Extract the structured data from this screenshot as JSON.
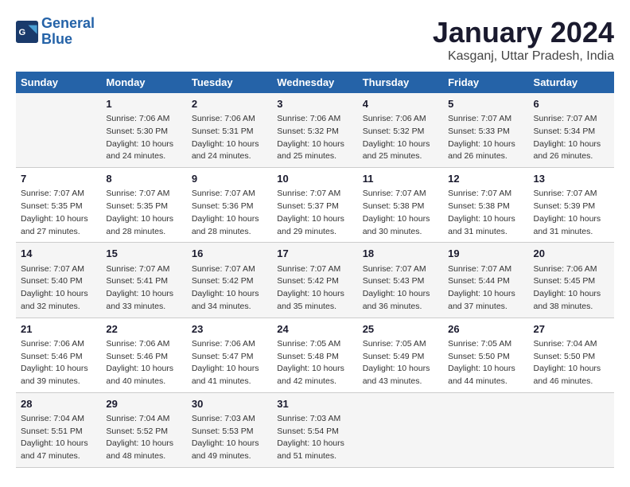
{
  "logo": {
    "text_general": "General",
    "text_blue": "Blue"
  },
  "title": "January 2024",
  "subtitle": "Kasganj, Uttar Pradesh, India",
  "days_header": [
    "Sunday",
    "Monday",
    "Tuesday",
    "Wednesday",
    "Thursday",
    "Friday",
    "Saturday"
  ],
  "weeks": [
    [
      {
        "num": "",
        "sunrise": "",
        "sunset": "",
        "daylight": ""
      },
      {
        "num": "1",
        "sunrise": "Sunrise: 7:06 AM",
        "sunset": "Sunset: 5:30 PM",
        "daylight": "Daylight: 10 hours and 24 minutes."
      },
      {
        "num": "2",
        "sunrise": "Sunrise: 7:06 AM",
        "sunset": "Sunset: 5:31 PM",
        "daylight": "Daylight: 10 hours and 24 minutes."
      },
      {
        "num": "3",
        "sunrise": "Sunrise: 7:06 AM",
        "sunset": "Sunset: 5:32 PM",
        "daylight": "Daylight: 10 hours and 25 minutes."
      },
      {
        "num": "4",
        "sunrise": "Sunrise: 7:06 AM",
        "sunset": "Sunset: 5:32 PM",
        "daylight": "Daylight: 10 hours and 25 minutes."
      },
      {
        "num": "5",
        "sunrise": "Sunrise: 7:07 AM",
        "sunset": "Sunset: 5:33 PM",
        "daylight": "Daylight: 10 hours and 26 minutes."
      },
      {
        "num": "6",
        "sunrise": "Sunrise: 7:07 AM",
        "sunset": "Sunset: 5:34 PM",
        "daylight": "Daylight: 10 hours and 26 minutes."
      }
    ],
    [
      {
        "num": "7",
        "sunrise": "Sunrise: 7:07 AM",
        "sunset": "Sunset: 5:35 PM",
        "daylight": "Daylight: 10 hours and 27 minutes."
      },
      {
        "num": "8",
        "sunrise": "Sunrise: 7:07 AM",
        "sunset": "Sunset: 5:35 PM",
        "daylight": "Daylight: 10 hours and 28 minutes."
      },
      {
        "num": "9",
        "sunrise": "Sunrise: 7:07 AM",
        "sunset": "Sunset: 5:36 PM",
        "daylight": "Daylight: 10 hours and 28 minutes."
      },
      {
        "num": "10",
        "sunrise": "Sunrise: 7:07 AM",
        "sunset": "Sunset: 5:37 PM",
        "daylight": "Daylight: 10 hours and 29 minutes."
      },
      {
        "num": "11",
        "sunrise": "Sunrise: 7:07 AM",
        "sunset": "Sunset: 5:38 PM",
        "daylight": "Daylight: 10 hours and 30 minutes."
      },
      {
        "num": "12",
        "sunrise": "Sunrise: 7:07 AM",
        "sunset": "Sunset: 5:38 PM",
        "daylight": "Daylight: 10 hours and 31 minutes."
      },
      {
        "num": "13",
        "sunrise": "Sunrise: 7:07 AM",
        "sunset": "Sunset: 5:39 PM",
        "daylight": "Daylight: 10 hours and 31 minutes."
      }
    ],
    [
      {
        "num": "14",
        "sunrise": "Sunrise: 7:07 AM",
        "sunset": "Sunset: 5:40 PM",
        "daylight": "Daylight: 10 hours and 32 minutes."
      },
      {
        "num": "15",
        "sunrise": "Sunrise: 7:07 AM",
        "sunset": "Sunset: 5:41 PM",
        "daylight": "Daylight: 10 hours and 33 minutes."
      },
      {
        "num": "16",
        "sunrise": "Sunrise: 7:07 AM",
        "sunset": "Sunset: 5:42 PM",
        "daylight": "Daylight: 10 hours and 34 minutes."
      },
      {
        "num": "17",
        "sunrise": "Sunrise: 7:07 AM",
        "sunset": "Sunset: 5:42 PM",
        "daylight": "Daylight: 10 hours and 35 minutes."
      },
      {
        "num": "18",
        "sunrise": "Sunrise: 7:07 AM",
        "sunset": "Sunset: 5:43 PM",
        "daylight": "Daylight: 10 hours and 36 minutes."
      },
      {
        "num": "19",
        "sunrise": "Sunrise: 7:07 AM",
        "sunset": "Sunset: 5:44 PM",
        "daylight": "Daylight: 10 hours and 37 minutes."
      },
      {
        "num": "20",
        "sunrise": "Sunrise: 7:06 AM",
        "sunset": "Sunset: 5:45 PM",
        "daylight": "Daylight: 10 hours and 38 minutes."
      }
    ],
    [
      {
        "num": "21",
        "sunrise": "Sunrise: 7:06 AM",
        "sunset": "Sunset: 5:46 PM",
        "daylight": "Daylight: 10 hours and 39 minutes."
      },
      {
        "num": "22",
        "sunrise": "Sunrise: 7:06 AM",
        "sunset": "Sunset: 5:46 PM",
        "daylight": "Daylight: 10 hours and 40 minutes."
      },
      {
        "num": "23",
        "sunrise": "Sunrise: 7:06 AM",
        "sunset": "Sunset: 5:47 PM",
        "daylight": "Daylight: 10 hours and 41 minutes."
      },
      {
        "num": "24",
        "sunrise": "Sunrise: 7:05 AM",
        "sunset": "Sunset: 5:48 PM",
        "daylight": "Daylight: 10 hours and 42 minutes."
      },
      {
        "num": "25",
        "sunrise": "Sunrise: 7:05 AM",
        "sunset": "Sunset: 5:49 PM",
        "daylight": "Daylight: 10 hours and 43 minutes."
      },
      {
        "num": "26",
        "sunrise": "Sunrise: 7:05 AM",
        "sunset": "Sunset: 5:50 PM",
        "daylight": "Daylight: 10 hours and 44 minutes."
      },
      {
        "num": "27",
        "sunrise": "Sunrise: 7:04 AM",
        "sunset": "Sunset: 5:50 PM",
        "daylight": "Daylight: 10 hours and 46 minutes."
      }
    ],
    [
      {
        "num": "28",
        "sunrise": "Sunrise: 7:04 AM",
        "sunset": "Sunset: 5:51 PM",
        "daylight": "Daylight: 10 hours and 47 minutes."
      },
      {
        "num": "29",
        "sunrise": "Sunrise: 7:04 AM",
        "sunset": "Sunset: 5:52 PM",
        "daylight": "Daylight: 10 hours and 48 minutes."
      },
      {
        "num": "30",
        "sunrise": "Sunrise: 7:03 AM",
        "sunset": "Sunset: 5:53 PM",
        "daylight": "Daylight: 10 hours and 49 minutes."
      },
      {
        "num": "31",
        "sunrise": "Sunrise: 7:03 AM",
        "sunset": "Sunset: 5:54 PM",
        "daylight": "Daylight: 10 hours and 51 minutes."
      },
      {
        "num": "",
        "sunrise": "",
        "sunset": "",
        "daylight": ""
      },
      {
        "num": "",
        "sunrise": "",
        "sunset": "",
        "daylight": ""
      },
      {
        "num": "",
        "sunrise": "",
        "sunset": "",
        "daylight": ""
      }
    ]
  ]
}
